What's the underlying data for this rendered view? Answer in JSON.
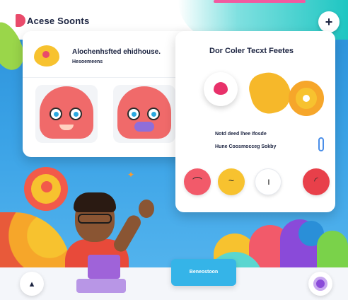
{
  "app": {
    "title": "Acese Soonts"
  },
  "header": {
    "add_label": "+"
  },
  "left_card": {
    "header_title": "Alochenhsfted ehidhouse.",
    "header_sub": "Hesoemeens"
  },
  "right_card": {
    "title": "Dor Coler Tecxt Feetes",
    "line1": "Notd deed lhee Ifosde",
    "line2": "Hune Coosmocceg Sokby"
  },
  "footer": {
    "cta_label": "Beneostoon",
    "left_icon": "▴",
    "right_icon": "record-icon"
  },
  "colors": {
    "accent_teal": "#1ec6c2",
    "accent_pink": "#f25aa0",
    "accent_yellow": "#f7c22f",
    "accent_red": "#e94b6b",
    "accent_purple": "#8a4ad9",
    "cta_blue": "#35b4e8"
  },
  "swatches": [
    {
      "name": "red-swatch",
      "color": "#f25a6a",
      "glyph": "⌒"
    },
    {
      "name": "yellow-swatch",
      "color": "#f7c22f",
      "glyph": "~"
    },
    {
      "name": "white-swatch",
      "color": "#ffffff",
      "glyph": "ı"
    },
    {
      "name": "coral-swatch",
      "color": "#e8404a",
      "glyph": "◜"
    }
  ]
}
